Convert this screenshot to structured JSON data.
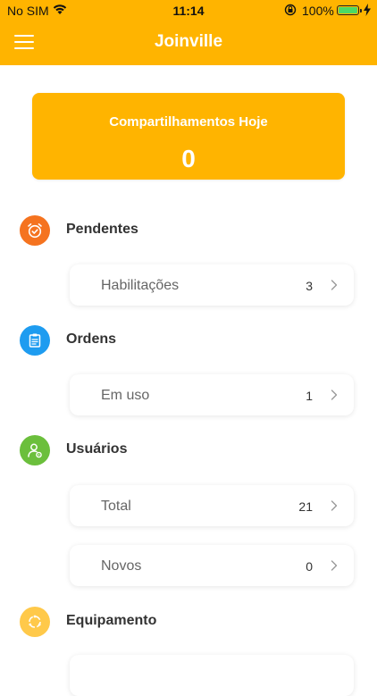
{
  "status_bar": {
    "carrier": "No SIM",
    "time": "11:14",
    "battery_percent": "100%"
  },
  "nav": {
    "title": "Joinville",
    "menu_icon": "hamburger-menu-icon"
  },
  "summary": {
    "title": "Compartilhamentos Hoje",
    "value": "0"
  },
  "sections": [
    {
      "title": "Pendentes",
      "icon": "alarm-clock-check-icon",
      "icon_color": "#f5731f",
      "items": [
        {
          "label": "Habilitações",
          "count": "3"
        }
      ]
    },
    {
      "title": "Ordens",
      "icon": "clipboard-icon",
      "icon_color": "#1e9cf0",
      "items": [
        {
          "label": "Em uso",
          "count": "1"
        }
      ]
    },
    {
      "title": "Usuários",
      "icon": "user-settings-icon",
      "icon_color": "#6bbf3c",
      "items": [
        {
          "label": "Total",
          "count": "21"
        },
        {
          "label": "Novos",
          "count": "0"
        }
      ]
    },
    {
      "title": "Equipamento",
      "icon": "refresh-circle-icon",
      "icon_color": "#ffc94a",
      "items": []
    }
  ],
  "colors": {
    "brand": "#ffb400",
    "text_primary": "#333333",
    "text_secondary": "#666666"
  }
}
